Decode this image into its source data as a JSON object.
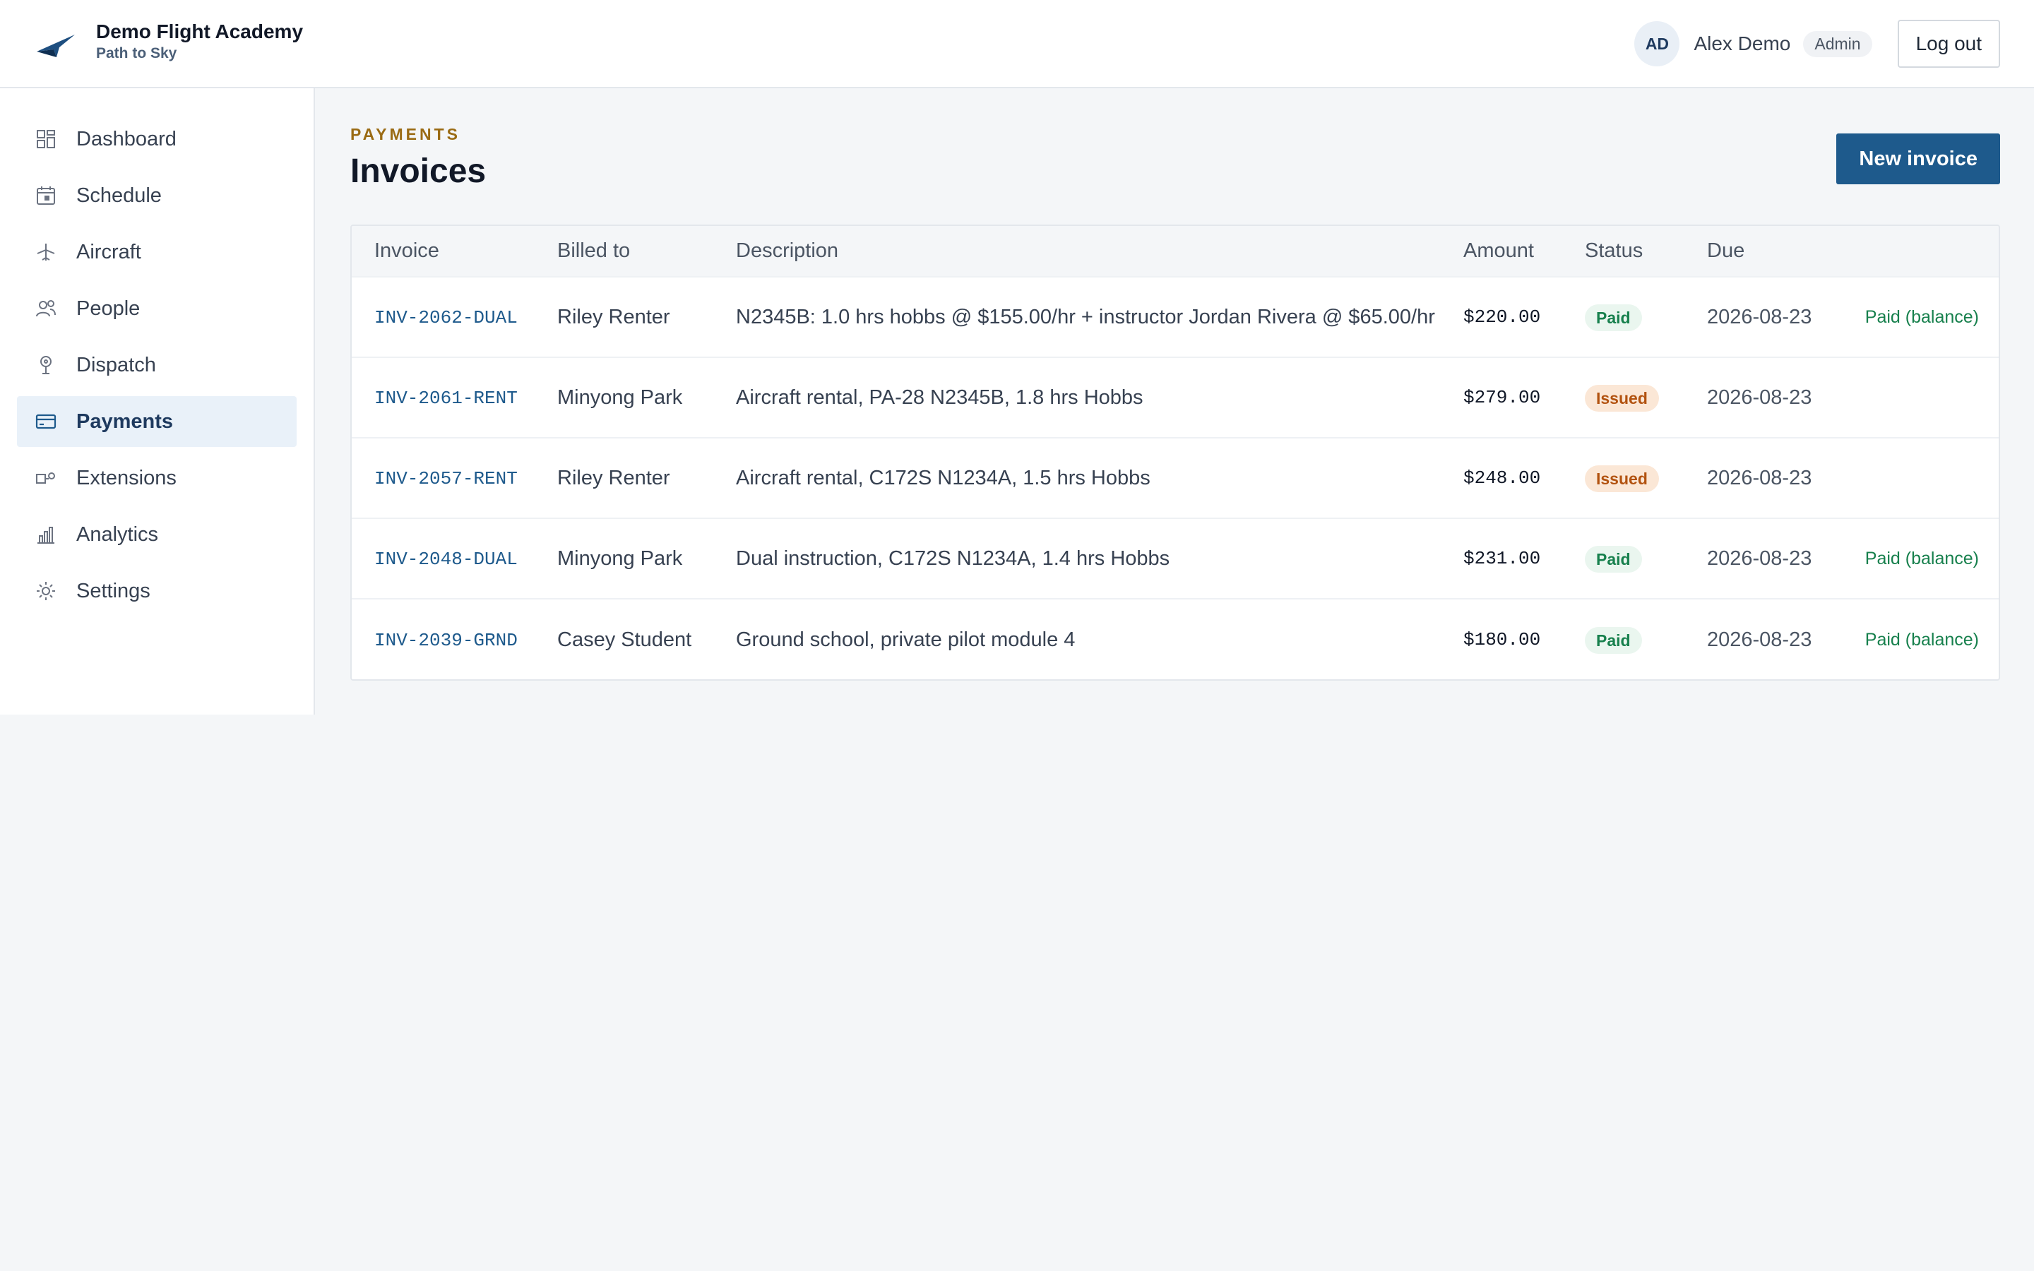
{
  "brand": {
    "title": "Demo Flight Academy",
    "subtitle": "Path to Sky",
    "logo_icon": "plane-wing-logo"
  },
  "user": {
    "initials": "AD",
    "name": "Alex Demo",
    "role": "Admin",
    "logout_label": "Log out"
  },
  "sidebar": {
    "items": [
      {
        "label": "Dashboard",
        "icon": "grid-icon",
        "active": false
      },
      {
        "label": "Schedule",
        "icon": "calendar-icon",
        "active": false
      },
      {
        "label": "Aircraft",
        "icon": "airplane-icon",
        "active": false
      },
      {
        "label": "People",
        "icon": "people-icon",
        "active": false
      },
      {
        "label": "Dispatch",
        "icon": "dispatch-icon",
        "active": false
      },
      {
        "label": "Payments",
        "icon": "credit-card-icon",
        "active": true
      },
      {
        "label": "Extensions",
        "icon": "extension-icon",
        "active": false
      },
      {
        "label": "Analytics",
        "icon": "bar-chart-icon",
        "active": false
      },
      {
        "label": "Settings",
        "icon": "gear-icon",
        "active": false
      }
    ]
  },
  "page": {
    "eyebrow": "PAYMENTS",
    "title": "Invoices",
    "new_invoice_label": "New invoice"
  },
  "table": {
    "columns": [
      "Invoice",
      "Billed to",
      "Description",
      "Amount",
      "Status",
      "Due"
    ],
    "rows": [
      {
        "invoice": "INV-2062-DUAL",
        "billed_to": "Riley Renter",
        "description": "N2345B: 1.0 hrs hobbs @ $155.00/hr + instructor Jordan Rivera @ $65.00/hr",
        "amount": "$220.00",
        "status": "Paid",
        "due": "2026-08-23",
        "note": "Paid (balance)"
      },
      {
        "invoice": "INV-2061-RENT",
        "billed_to": "Minyong Park",
        "description": "Aircraft rental, PA-28 N2345B, 1.8 hrs Hobbs",
        "amount": "$279.00",
        "status": "Issued",
        "due": "2026-08-23",
        "note": ""
      },
      {
        "invoice": "INV-2057-RENT",
        "billed_to": "Riley Renter",
        "description": "Aircraft rental, C172S N1234A, 1.5 hrs Hobbs",
        "amount": "$248.00",
        "status": "Issued",
        "due": "2026-08-23",
        "note": ""
      },
      {
        "invoice": "INV-2048-DUAL",
        "billed_to": "Minyong Park",
        "description": "Dual instruction, C172S N1234A, 1.4 hrs Hobbs",
        "amount": "$231.00",
        "status": "Paid",
        "due": "2026-08-23",
        "note": "Paid (balance)"
      },
      {
        "invoice": "INV-2039-GRND",
        "billed_to": "Casey Student",
        "description": "Ground school, private pilot module 4",
        "amount": "$180.00",
        "status": "Paid",
        "due": "2026-08-23",
        "note": "Paid (balance)"
      }
    ]
  },
  "colors": {
    "accent": "#1e5a8c",
    "paid": "#17804d",
    "issued": "#b2520f",
    "eyebrow": "#9a6b14"
  }
}
